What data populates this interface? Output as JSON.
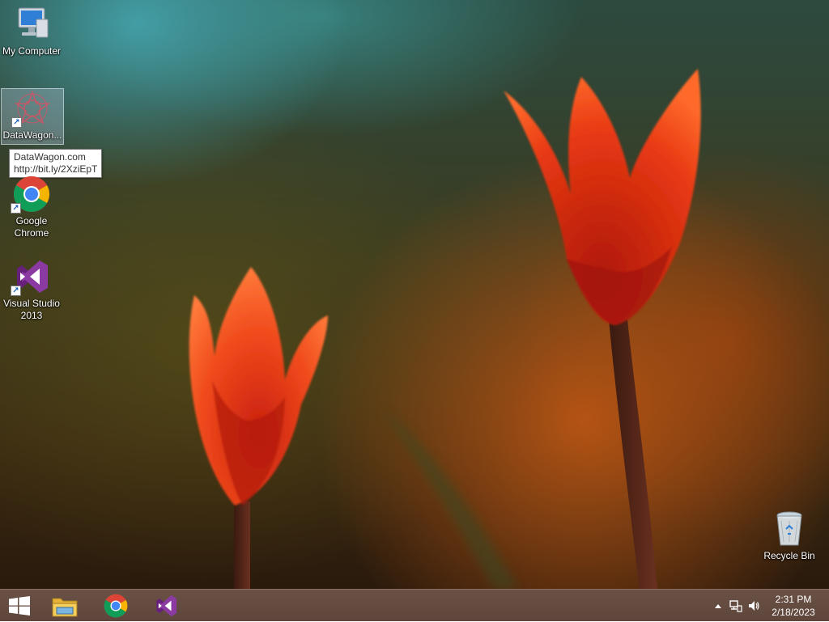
{
  "desktop": {
    "icons": [
      {
        "label": "My Computer",
        "icon": "computer-icon"
      },
      {
        "label": "DataWagon...",
        "icon": "datawagon-icon"
      },
      {
        "label": "Google Chrome",
        "icon": "chrome-icon"
      },
      {
        "label": "Visual Studio 2013",
        "icon": "visual-studio-icon"
      },
      {
        "label": "Recycle Bin",
        "icon": "recycle-bin-icon"
      }
    ],
    "tooltip": {
      "line1": "DataWagon.com",
      "line2": "http://bit.ly/2XziEpT"
    }
  },
  "taskbar": {
    "start_icon": "windows-logo-icon",
    "pinned": [
      {
        "icon": "file-explorer-icon"
      },
      {
        "icon": "chrome-icon"
      },
      {
        "icon": "visual-studio-icon"
      }
    ],
    "tray": {
      "icons": [
        "show-hidden-icons-arrow",
        "network-icon",
        "volume-icon"
      ],
      "time": "2:31 PM",
      "date": "2/18/2023"
    }
  },
  "colors": {
    "taskbar": "#5e463c",
    "tulip": "#f0401a",
    "vs_purple": "#68217a",
    "chrome_red": "#db4437",
    "chrome_yellow": "#f4b400",
    "chrome_green": "#0f9d58",
    "chrome_blue": "#4285f4"
  }
}
